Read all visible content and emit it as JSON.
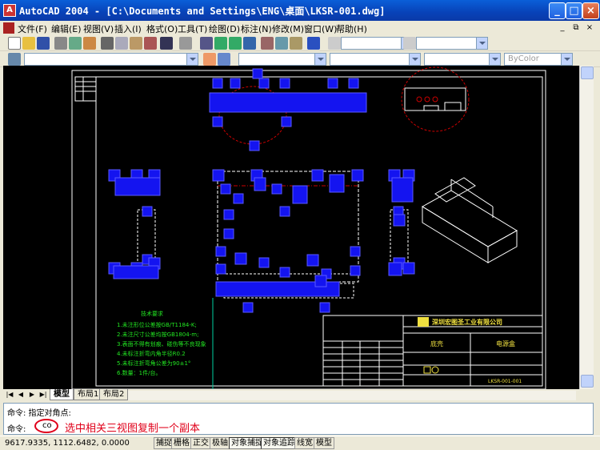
{
  "window": {
    "title": "AutoCAD 2004 - [C:\\Documents and Settings\\ENG\\桌面\\LKSR-001.dwg]",
    "app_icon": "autocad-icon"
  },
  "menu": {
    "items": [
      "文件(F)",
      "编辑(E)",
      "视图(V)",
      "插入(I)",
      "格式(O)",
      "工具(T)",
      "绘图(D)",
      "标注(N)",
      "修改(M)",
      "窗口(W)",
      "帮助(H)"
    ]
  },
  "toolbar": {
    "linetype_value": "ByColor"
  },
  "drawing": {
    "tech_req_title": "技术要求",
    "tech_req_lines": [
      "1.未注形位公差按GB/T1184-K;",
      "2.未注尺寸公差均按GB1804-m;",
      "3.表面不得有划痕、碰伤等不良现象",
      "4.未标注折弯内角半径R0.2",
      "5.未标注折弯角公差为90±1°",
      "6.数量：1件/台。"
    ],
    "company": "深圳宏图圣工业有限公司",
    "title_cells": [
      "底壳",
      "电源盒",
      "LKSR-001-001"
    ]
  },
  "tabs": [
    "模型",
    "布局1",
    "布局2"
  ],
  "command": {
    "line1": "命令: 指定对角点:",
    "prompt": "命令:",
    "input": "co",
    "annotation": "选中相关三视图复制一个副本"
  },
  "status": {
    "coords": "9617.9335,  1112.6482,  0.0000",
    "buttons": [
      "捕捉",
      "栅格",
      "正交",
      "极轴",
      "对象捕捉",
      "对象追踪",
      "线宽",
      "模型"
    ]
  },
  "colors": {
    "grip": "#1414F0",
    "canvas": "#000000",
    "annotation": "#E0001A"
  }
}
